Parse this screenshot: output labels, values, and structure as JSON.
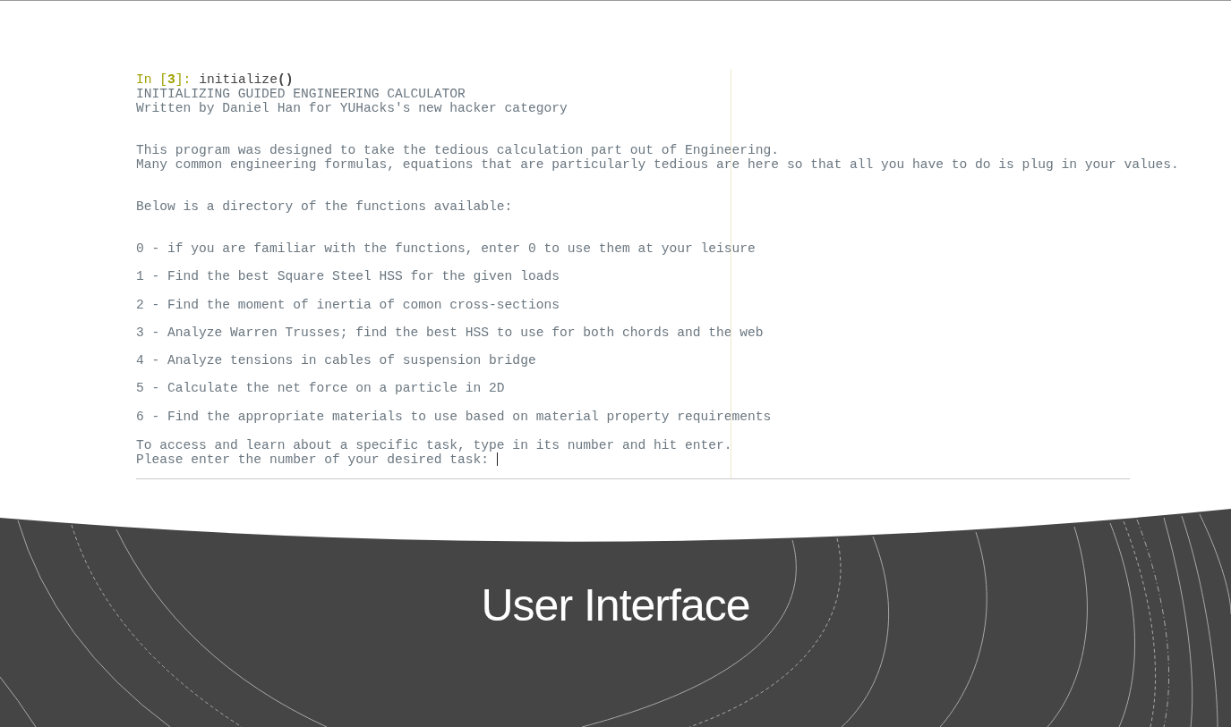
{
  "cell": {
    "prompt": "In [**3**]:",
    "code": "initialize**()**",
    "output": {
      "header": [
        "INITIALIZING GUIDED ENGINEERING CALCULATOR",
        "Written by Daniel Han for YUHacks's new hacker category"
      ],
      "intro": [
        "This program was designed to take the tedious calculation part out of Engineering.",
        "Many common engineering formulas, equations that are particularly tedious are here so that all you have to do is plug in your values."
      ],
      "directory_heading": "Below is a directory of the functions available:",
      "options": [
        "0 - if you are familiar with the functions, enter 0 to use them at your leisure",
        "1 - Find the best Square Steel HSS for the given loads",
        "2 - Find the moment of inertia of comon cross-sections",
        "3 - Analyze Warren Trusses; find the best HSS to use for both chords and the web",
        "4 - Analyze tensions in cables of suspension bridge",
        "5 - Calculate the net force on a particle in 2D",
        "6 - Find the appropriate materials to use based on material property requirements"
      ],
      "instruction": "To access and learn about a specific task, type in its number and hit enter.",
      "input_prompt": "Please enter the number of your desired task:"
    }
  },
  "section_title": "User Interface"
}
